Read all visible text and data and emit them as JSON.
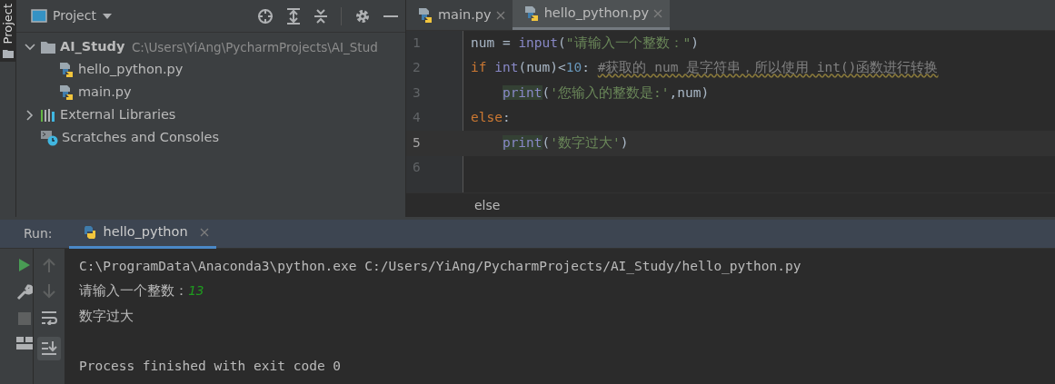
{
  "side_strip": {
    "label": "Project"
  },
  "project_panel": {
    "title": "Project",
    "tree": [
      {
        "label": "AI_Study",
        "path": "C:\\Users\\YiAng\\PycharmProjects\\AI_Stud",
        "kind": "folder",
        "expanded": true,
        "children": [
          {
            "label": "hello_python.py",
            "kind": "python"
          },
          {
            "label": "main.py",
            "kind": "python"
          }
        ]
      },
      {
        "label": "External Libraries",
        "kind": "libraries",
        "expanded": false
      },
      {
        "label": "Scratches and Consoles",
        "kind": "scratches"
      }
    ]
  },
  "editor": {
    "tabs": [
      {
        "label": "main.py",
        "selected": false
      },
      {
        "label": "hello_python.py",
        "selected": true
      }
    ],
    "lines": [
      {
        "number": "1",
        "selected": false,
        "indented": false,
        "tokens": [
          {
            "text": "num = ",
            "kind": "plain"
          },
          {
            "text": "input",
            "kind": "builtin"
          },
          {
            "text": "(",
            "kind": "plain"
          },
          {
            "text": "\"请输入一个整数：\"",
            "kind": "string"
          },
          {
            "text": ")",
            "kind": "plain"
          }
        ]
      },
      {
        "number": "2",
        "selected": false,
        "indented": false,
        "tokens": [
          {
            "text": "if ",
            "kind": "keyword"
          },
          {
            "text": "int",
            "kind": "builtin"
          },
          {
            "text": "(num)<",
            "kind": "plain"
          },
          {
            "text": "10",
            "kind": "number"
          },
          {
            "text": ": ",
            "kind": "plain"
          },
          {
            "text": "#获取的 num 是字符串，所以使用 int()函数进行转换",
            "kind": "comment"
          }
        ]
      },
      {
        "number": "3",
        "selected": false,
        "indented": true,
        "tokens": [
          {
            "text": "print",
            "kind": "call"
          },
          {
            "text": "(",
            "kind": "plain"
          },
          {
            "text": "'您输入的整数是:'",
            "kind": "string"
          },
          {
            "text": ",num)",
            "kind": "plain"
          }
        ]
      },
      {
        "number": "4",
        "selected": false,
        "indented": false,
        "tokens": [
          {
            "text": "else",
            "kind": "keyword"
          },
          {
            "text": ":",
            "kind": "plain"
          }
        ]
      },
      {
        "number": "5",
        "selected": true,
        "indented": true,
        "tokens": [
          {
            "text": "print",
            "kind": "call"
          },
          {
            "text": "(",
            "kind": "plain"
          },
          {
            "text": "'数字过大'",
            "kind": "string"
          },
          {
            "text": ")",
            "kind": "plain"
          }
        ]
      },
      {
        "number": "6",
        "selected": false
      }
    ],
    "breadcrumb": "else"
  },
  "run_panel": {
    "label": "Run:",
    "tabs": [
      {
        "label": "hello_python",
        "selected": true
      }
    ],
    "console": [
      {
        "kind": "command",
        "text": "C:\\ProgramData\\Anaconda3\\python.exe C:/Users/YiAng/PycharmProjects/AI_Study/hello_python.py"
      },
      {
        "kind": "prompt",
        "text": "请输入一个整数：",
        "input": "13"
      },
      {
        "kind": "output",
        "text": "数字过大"
      },
      {
        "kind": "blank"
      },
      {
        "kind": "output",
        "text": "Process finished with exit code 0"
      }
    ]
  }
}
